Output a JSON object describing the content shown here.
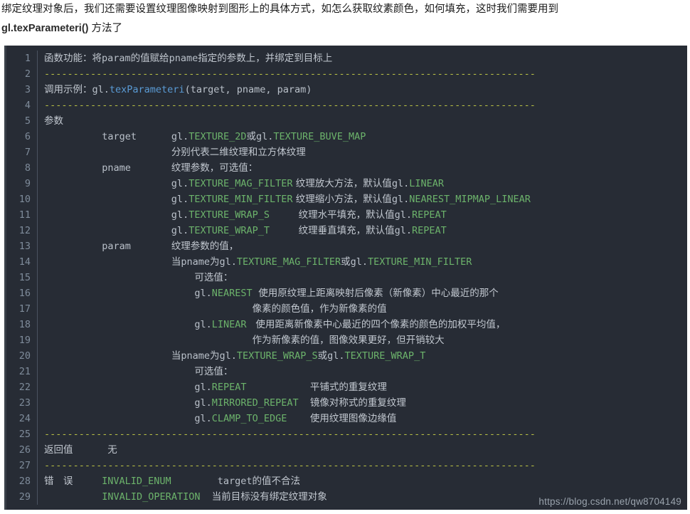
{
  "intro": {
    "line1": "绑定纹理对象后，我们还需要设置纹理图像映射到图形上的具体方式，如怎么获取纹素颜色，如何填充，这时我们需要用到",
    "line2_code": "gl.texParameteri()",
    "line2_tail": " 方法了"
  },
  "watermark": "https://blog.csdn.net/qw8704149",
  "colors": {
    "code_background": "#272c35",
    "gutter_text": "#7f8c9b",
    "plain_text": "#b9c0c9",
    "constant_green": "#6cb36b",
    "function_blue": "#5a9bd5",
    "dash_yellow": "#b5bd44",
    "page_background": "#ffffff"
  },
  "code": {
    "dash_rule": "-------------------------------------------------------------------------------------",
    "lines": [
      {
        "n": "1",
        "segments": [
          {
            "t": "cjk",
            "s": "函数功能：将"
          },
          {
            "t": "plain",
            "s": "param"
          },
          {
            "t": "cjk",
            "s": "的值赋给"
          },
          {
            "t": "plain",
            "s": "pname"
          },
          {
            "t": "cjk",
            "s": "指定的参数上，并绑定到目标上"
          }
        ]
      },
      {
        "n": "2",
        "segments": [
          {
            "t": "dash",
            "s": "-------------------------------------------------------------------------------------"
          }
        ]
      },
      {
        "n": "3",
        "segments": [
          {
            "t": "cjk",
            "s": "调用示例："
          },
          {
            "t": "plain",
            "s": "gl."
          },
          {
            "t": "func",
            "s": "texParameteri"
          },
          {
            "t": "plain",
            "s": "(target, pname, param)"
          }
        ]
      },
      {
        "n": "4",
        "segments": [
          {
            "t": "dash",
            "s": "-------------------------------------------------------------------------------------"
          }
        ]
      },
      {
        "n": "5",
        "segments": [
          {
            "t": "cjk",
            "s": "参数"
          }
        ]
      },
      {
        "n": "6",
        "segments": [
          {
            "t": "plain",
            "s": "          target      "
          },
          {
            "t": "plain",
            "s": "gl."
          },
          {
            "t": "const",
            "s": "TEXTURE_2D"
          },
          {
            "t": "cjk",
            "s": "或"
          },
          {
            "t": "plain",
            "s": "gl."
          },
          {
            "t": "const",
            "s": "TEXTURE_BUVE_MAP"
          }
        ]
      },
      {
        "n": "7",
        "segments": [
          {
            "t": "plain",
            "s": "                      "
          },
          {
            "t": "cjk",
            "s": "分别代表二维纹理和立方体纹理"
          }
        ]
      },
      {
        "n": "8",
        "segments": [
          {
            "t": "plain",
            "s": "          pname       "
          },
          {
            "t": "cjk",
            "s": "纹理参数，可选值："
          }
        ]
      },
      {
        "n": "9",
        "segments": [
          {
            "t": "plain",
            "s": "                      gl."
          },
          {
            "t": "const",
            "s": "TEXTURE_MAG_FILTER"
          },
          {
            "t": "cjk",
            "s": " 纹理放大方法，默认值"
          },
          {
            "t": "plain",
            "s": "gl."
          },
          {
            "t": "const",
            "s": "LINEAR"
          }
        ]
      },
      {
        "n": "10",
        "segments": [
          {
            "t": "plain",
            "s": "                      gl."
          },
          {
            "t": "const",
            "s": "TEXTURE_MIN_FILTER"
          },
          {
            "t": "cjk",
            "s": " 纹理缩小方法，默认值"
          },
          {
            "t": "plain",
            "s": "gl."
          },
          {
            "t": "const",
            "s": "NEAREST_MIPMAP_LINEAR"
          }
        ]
      },
      {
        "n": "11",
        "segments": [
          {
            "t": "plain",
            "s": "                      gl."
          },
          {
            "t": "const",
            "s": "TEXTURE_WRAP_S"
          },
          {
            "t": "plain",
            "s": "     "
          },
          {
            "t": "cjk",
            "s": "纹理水平填充，默认值"
          },
          {
            "t": "plain",
            "s": "gl."
          },
          {
            "t": "const",
            "s": "REPEAT"
          }
        ]
      },
      {
        "n": "12",
        "segments": [
          {
            "t": "plain",
            "s": "                      gl."
          },
          {
            "t": "const",
            "s": "TEXTURE_WRAP_T"
          },
          {
            "t": "plain",
            "s": "     "
          },
          {
            "t": "cjk",
            "s": "纹理垂直填充，默认值"
          },
          {
            "t": "plain",
            "s": "gl."
          },
          {
            "t": "const",
            "s": "REPEAT"
          }
        ]
      },
      {
        "n": "13",
        "segments": [
          {
            "t": "plain",
            "s": "          param       "
          },
          {
            "t": "cjk",
            "s": "纹理参数的值，"
          }
        ]
      },
      {
        "n": "14",
        "segments": [
          {
            "t": "plain",
            "s": "                      "
          },
          {
            "t": "cjk",
            "s": "当"
          },
          {
            "t": "plain",
            "s": "pname"
          },
          {
            "t": "cjk",
            "s": "为"
          },
          {
            "t": "plain",
            "s": "gl."
          },
          {
            "t": "const",
            "s": "TEXTURE_MAG_FILTER"
          },
          {
            "t": "cjk",
            "s": "或"
          },
          {
            "t": "plain",
            "s": "gl."
          },
          {
            "t": "const",
            "s": "TEXTURE_MIN_FILTER"
          }
        ]
      },
      {
        "n": "15",
        "segments": [
          {
            "t": "plain",
            "s": "                          "
          },
          {
            "t": "cjk",
            "s": "可选值："
          }
        ]
      },
      {
        "n": "16",
        "segments": [
          {
            "t": "plain",
            "s": "                          gl."
          },
          {
            "t": "const",
            "s": "NEAREST"
          },
          {
            "t": "cjk",
            "s": "  使用原纹理上距离映射后像素（新像素）中心最近的那个"
          }
        ]
      },
      {
        "n": "17",
        "segments": [
          {
            "t": "plain",
            "s": "                                    "
          },
          {
            "t": "cjk",
            "s": "像素的颜色值，作为新像素的值"
          }
        ]
      },
      {
        "n": "18",
        "segments": [
          {
            "t": "plain",
            "s": "                          gl."
          },
          {
            "t": "const",
            "s": "LINEAR"
          },
          {
            "t": "cjk",
            "s": "   使用距离新像素中心最近的四个像素的颜色的加权平均值，"
          }
        ]
      },
      {
        "n": "19",
        "segments": [
          {
            "t": "plain",
            "s": "                                    "
          },
          {
            "t": "cjk",
            "s": "作为新像素的值，图像效果更好，但开销较大"
          }
        ]
      },
      {
        "n": "20",
        "segments": [
          {
            "t": "plain",
            "s": "                      "
          },
          {
            "t": "cjk",
            "s": "当"
          },
          {
            "t": "plain",
            "s": "pname"
          },
          {
            "t": "cjk",
            "s": "为"
          },
          {
            "t": "plain",
            "s": "gl."
          },
          {
            "t": "const",
            "s": "TEXTURE_WRAP_S"
          },
          {
            "t": "cjk",
            "s": "或"
          },
          {
            "t": "plain",
            "s": "gl."
          },
          {
            "t": "const",
            "s": "TEXTURE_WRAP_T"
          }
        ]
      },
      {
        "n": "21",
        "segments": [
          {
            "t": "plain",
            "s": "                          "
          },
          {
            "t": "cjk",
            "s": "可选值："
          }
        ]
      },
      {
        "n": "22",
        "segments": [
          {
            "t": "plain",
            "s": "                          gl."
          },
          {
            "t": "const",
            "s": "REPEAT"
          },
          {
            "t": "plain",
            "s": "           "
          },
          {
            "t": "cjk",
            "s": "平铺式的重复纹理"
          }
        ]
      },
      {
        "n": "23",
        "segments": [
          {
            "t": "plain",
            "s": "                          gl."
          },
          {
            "t": "const",
            "s": "MIRRORED_REPEAT"
          },
          {
            "t": "plain",
            "s": "  "
          },
          {
            "t": "cjk",
            "s": "镜像对称式的重复纹理"
          }
        ]
      },
      {
        "n": "24",
        "segments": [
          {
            "t": "plain",
            "s": "                          gl."
          },
          {
            "t": "const",
            "s": "CLAMP_TO_EDGE"
          },
          {
            "t": "plain",
            "s": "    "
          },
          {
            "t": "cjk",
            "s": "使用纹理图像边缘值"
          }
        ]
      },
      {
        "n": "25",
        "segments": [
          {
            "t": "dash",
            "s": "-------------------------------------------------------------------------------------"
          }
        ]
      },
      {
        "n": "26",
        "segments": [
          {
            "t": "cjk",
            "s": "返回值"
          },
          {
            "t": "plain",
            "s": "      "
          },
          {
            "t": "cjk",
            "s": "无"
          }
        ]
      },
      {
        "n": "27",
        "segments": [
          {
            "t": "dash",
            "s": "-------------------------------------------------------------------------------------"
          }
        ]
      },
      {
        "n": "28",
        "segments": [
          {
            "t": "cjk",
            "s": "错　误"
          },
          {
            "t": "plain",
            "s": "     "
          },
          {
            "t": "const",
            "s": "INVALID_ENUM"
          },
          {
            "t": "plain",
            "s": "        target"
          },
          {
            "t": "cjk",
            "s": "的值不合法"
          }
        ]
      },
      {
        "n": "29",
        "segments": [
          {
            "t": "plain",
            "s": "          "
          },
          {
            "t": "const",
            "s": "INVALID_OPERATION"
          },
          {
            "t": "plain",
            "s": "  "
          },
          {
            "t": "cjk",
            "s": "当前目标没有绑定纹理对象"
          }
        ]
      }
    ]
  }
}
